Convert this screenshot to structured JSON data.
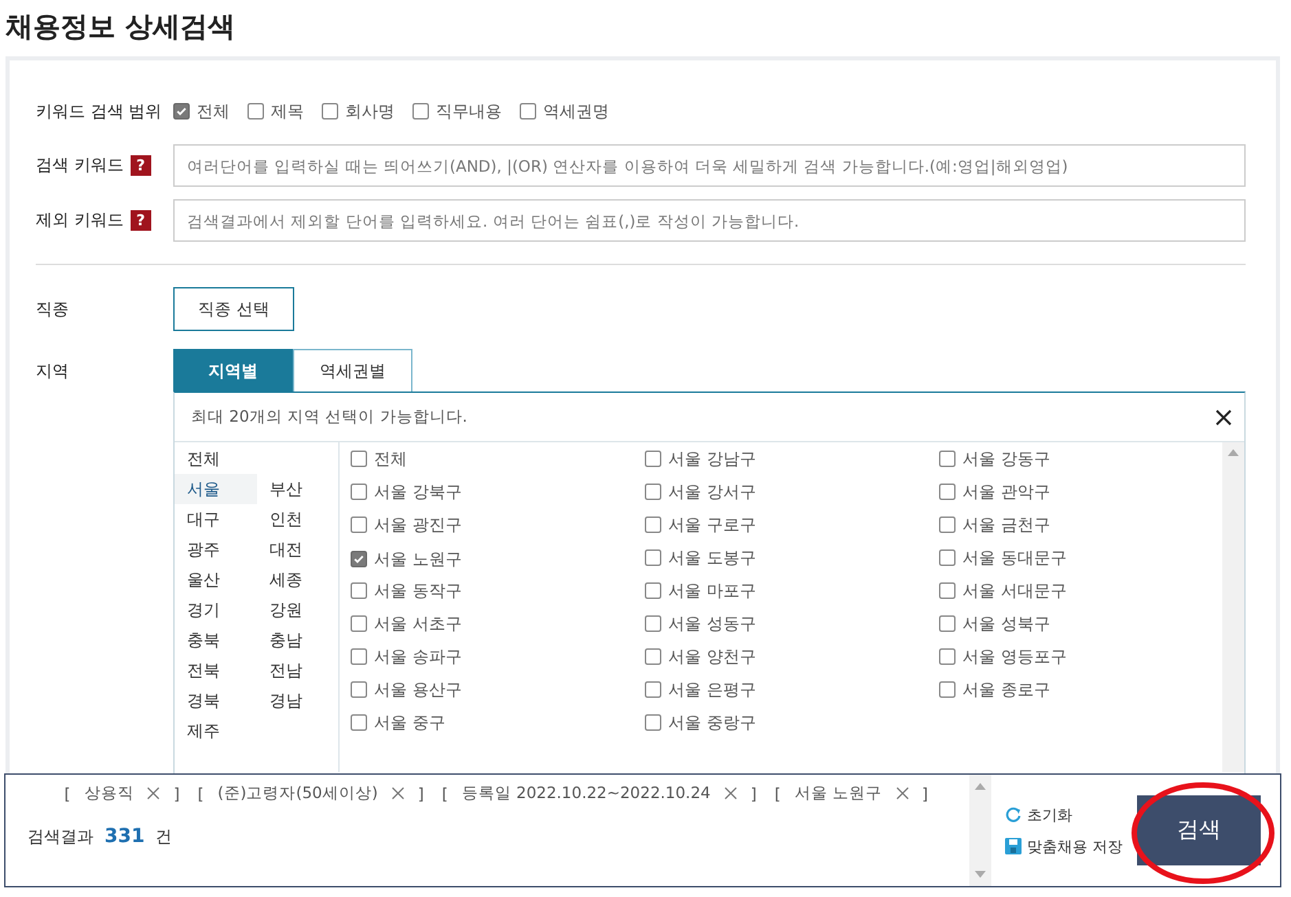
{
  "title": "채용정보 상세검색",
  "scope": {
    "label": "키워드 검색 범위",
    "options": [
      {
        "label": "전체",
        "checked": true
      },
      {
        "label": "제목",
        "checked": false
      },
      {
        "label": "회사명",
        "checked": false
      },
      {
        "label": "직무내용",
        "checked": false
      },
      {
        "label": "역세권명",
        "checked": false
      }
    ]
  },
  "keyword_fields": [
    {
      "label": "검색 키워드",
      "help": "?",
      "placeholder": "여러단어를 입력하실 때는 띄어쓰기(AND), |(OR) 연산자를 이용하여 더욱 세밀하게 검색 가능합니다.(예:영업|해외영업)"
    },
    {
      "label": "제외 키워드",
      "help": "?",
      "placeholder": "검색결과에서 제외할 단어를 입력하세요. 여러 단어는 쉼표(,)로 작성이 가능합니다."
    }
  ],
  "job": {
    "label": "직종",
    "button": "직종 선택"
  },
  "region": {
    "label": "지역",
    "tabs": [
      {
        "label": "지역별",
        "selected": true
      },
      {
        "label": "역세권별",
        "selected": false
      }
    ],
    "notice": "최대 20개의 지역 선택이 가능합니다.",
    "provinces": [
      {
        "label": "전체",
        "selected": false
      },
      {
        "label": "서울",
        "selected": true
      },
      {
        "label": "부산",
        "selected": false
      },
      {
        "label": "대구",
        "selected": false
      },
      {
        "label": "인천",
        "selected": false
      },
      {
        "label": "광주",
        "selected": false
      },
      {
        "label": "대전",
        "selected": false
      },
      {
        "label": "울산",
        "selected": false
      },
      {
        "label": "세종",
        "selected": false
      },
      {
        "label": "경기",
        "selected": false
      },
      {
        "label": "강원",
        "selected": false
      },
      {
        "label": "충북",
        "selected": false
      },
      {
        "label": "충남",
        "selected": false
      },
      {
        "label": "전북",
        "selected": false
      },
      {
        "label": "전남",
        "selected": false
      },
      {
        "label": "경북",
        "selected": false
      },
      {
        "label": "경남",
        "selected": false
      },
      {
        "label": "제주",
        "selected": false
      }
    ],
    "districts": [
      {
        "label": "전체",
        "checked": false
      },
      {
        "label": "서울 강남구",
        "checked": false
      },
      {
        "label": "서울 강동구",
        "checked": false
      },
      {
        "label": "서울 강북구",
        "checked": false
      },
      {
        "label": "서울 강서구",
        "checked": false
      },
      {
        "label": "서울 관악구",
        "checked": false
      },
      {
        "label": "서울 광진구",
        "checked": false
      },
      {
        "label": "서울 구로구",
        "checked": false
      },
      {
        "label": "서울 금천구",
        "checked": false
      },
      {
        "label": "서울 노원구",
        "checked": true
      },
      {
        "label": "서울 도봉구",
        "checked": false
      },
      {
        "label": "서울 동대문구",
        "checked": false
      },
      {
        "label": "서울 동작구",
        "checked": false
      },
      {
        "label": "서울 마포구",
        "checked": false
      },
      {
        "label": "서울 서대문구",
        "checked": false
      },
      {
        "label": "서울 서초구",
        "checked": false
      },
      {
        "label": "서울 성동구",
        "checked": false
      },
      {
        "label": "서울 성북구",
        "checked": false
      },
      {
        "label": "서울 송파구",
        "checked": false
      },
      {
        "label": "서울 양천구",
        "checked": false
      },
      {
        "label": "서울 영등포구",
        "checked": false
      },
      {
        "label": "서울 용산구",
        "checked": false
      },
      {
        "label": "서울 은평구",
        "checked": false
      },
      {
        "label": "서울 종로구",
        "checked": false
      },
      {
        "label": "서울 중구",
        "checked": false
      },
      {
        "label": "서울 중랑구",
        "checked": false
      }
    ]
  },
  "footer": {
    "result_label": "검색결과",
    "result_count": "331",
    "result_unit": "건",
    "tags": [
      {
        "open": "[",
        "label": "상용직",
        "close": "]"
      },
      {
        "open": "[",
        "label": "(준)고령자(50세이상)",
        "close": "]"
      },
      {
        "open": "[",
        "label": "등록일 2022.10.22~2022.10.24",
        "close": "]"
      },
      {
        "open": "[",
        "label": "서울 노원구",
        "close": "]"
      }
    ],
    "reset": "초기화",
    "save": "맞춤채용 저장",
    "search_button": "검색"
  }
}
